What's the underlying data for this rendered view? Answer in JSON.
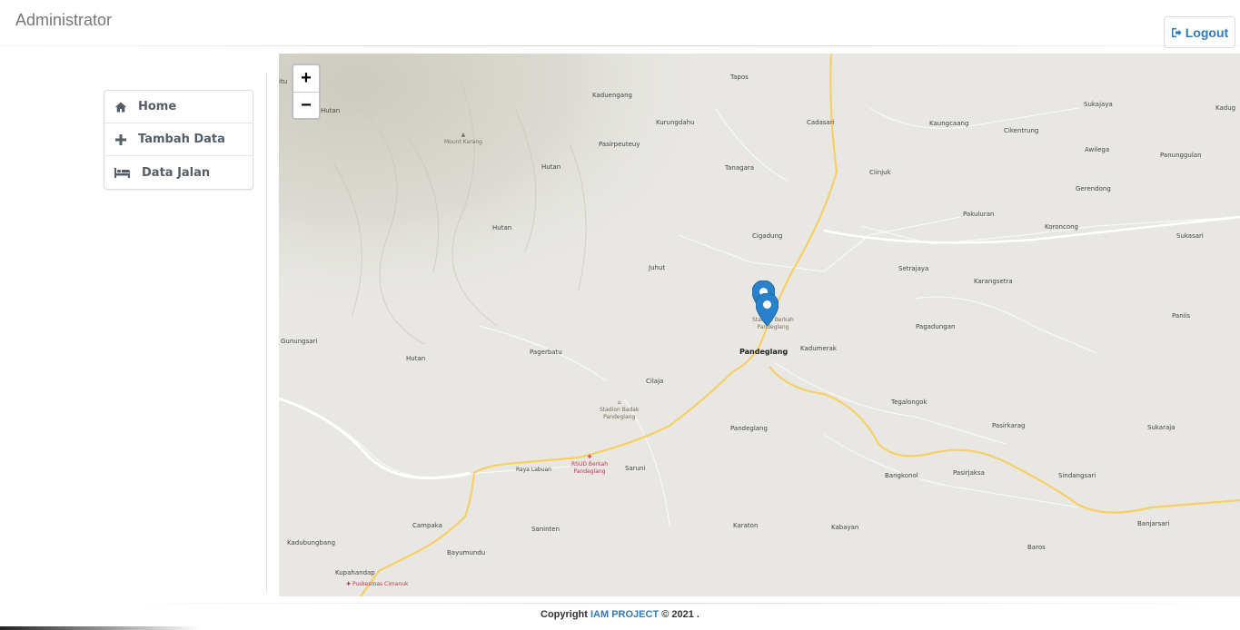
{
  "header": {
    "title": "Administrator",
    "logout_label": "Logout"
  },
  "sidebar": {
    "items": [
      {
        "label": "Home",
        "icon": "home-icon"
      },
      {
        "label": "Tambah Data",
        "icon": "plus-icon"
      },
      {
        "label": "Data Jalan",
        "icon": "bed-icon"
      }
    ]
  },
  "map": {
    "zoom_in": "+",
    "zoom_out": "−",
    "marker_color": "#2a81cb",
    "road_color": "#f6cf65",
    "places": {
      "tapos": "Tapos",
      "kaduengang": "Kaduengang",
      "kurungdahu": "Kurungdahu",
      "cadasari": "Cadasari",
      "kaungcaang": "Kaungcaang",
      "sukajaya": "Sukajaya",
      "kadug": "Kadug",
      "hutan1": "Hutan",
      "itu": "itu",
      "mount_karang": "Mount Karang",
      "pasirpeuteuy": "Pasirpeuteuy",
      "cikentrung": "Cikentrung",
      "awilega": "Awilega",
      "panunggulan": "Panunggulan",
      "hutan2": "Hutan",
      "tanagara": "Tanagara",
      "ciinjuk": "Ciinjuk",
      "gerendong": "Gerendong",
      "pakuluran": "Pakuluran",
      "hutan3": "Hutan",
      "koroncong": "Koroncong",
      "cigadung": "Cigadung",
      "sukasari": "Sukasari",
      "juhut": "Juhut",
      "setrajaya": "Setrajaya",
      "karangsetra": "Karangsetra",
      "stadion_berkah_1": "Stadion Berkah",
      "stadion_berkah_2": "Pandeglang",
      "panis": "Paniis",
      "pagadungan": "Pagadungan",
      "gunungsari": "Gunungsari",
      "pandeglang": "Pandeglang",
      "kadumerak": "Kadumerak",
      "pagerbatu": "Pagerbatu",
      "hutan4": "Hutan",
      "cilaja": "Cilaja",
      "tegalongok": "Tegalongok",
      "stadion_badak_1": "Stadion Badak",
      "stadion_badak_2": "Pandeglang",
      "pandeglang2": "Pandeglang",
      "pasirkarag": "Pasirkarag",
      "sukaraja": "Sukaraja",
      "raya_labuan": "Raya Labuan",
      "rsud_1": "RSUD Berkah",
      "rsud_2": "Pandeglang",
      "saruni": "Saruni",
      "bangkonol": "Bangkonol",
      "pasirjaksa": "Pasirjaksa",
      "sindangsari": "Sindangsari",
      "campaka": "Campaka",
      "saninten": "Saninten",
      "karaton": "Karaton",
      "kabayan": "Kabayan",
      "banjarsari": "Banjarsari",
      "kadubungbang": "Kadubungbang",
      "bayumundu": "Bayumundu",
      "baros": "Baros",
      "kupahandap": "Kupahandap",
      "puskesmas": "Puskesmas Cimanuk"
    }
  },
  "footer": {
    "prefix": "Copyright ",
    "brand": "IAM PROJECT",
    "suffix": " © 2021 ."
  }
}
